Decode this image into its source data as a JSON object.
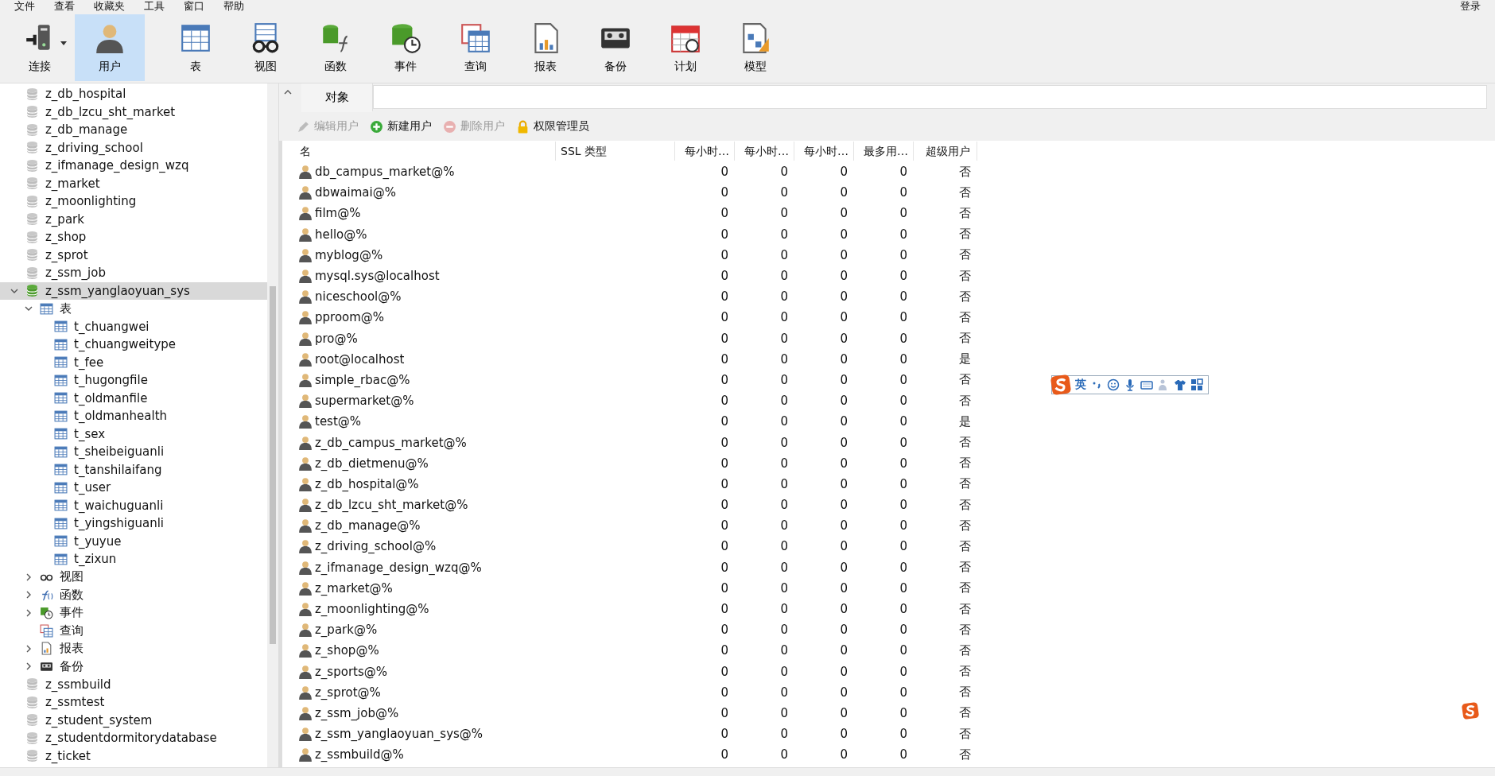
{
  "menu_bar": {
    "items": [
      "文件",
      "查看",
      "收藏夹",
      "工具",
      "窗口",
      "帮助"
    ],
    "login": "登录"
  },
  "toolbar": [
    {
      "label": "连接",
      "kind": "plug",
      "selected": false,
      "dropdown": true
    },
    {
      "label": "用户",
      "kind": "user",
      "selected": true
    },
    {
      "label": "表",
      "kind": "table",
      "selected": false
    },
    {
      "label": "视图",
      "kind": "view",
      "selected": false
    },
    {
      "label": "函数",
      "kind": "function",
      "selected": false
    },
    {
      "label": "事件",
      "kind": "event",
      "selected": false
    },
    {
      "label": "查询",
      "kind": "query",
      "selected": false
    },
    {
      "label": "报表",
      "kind": "report",
      "selected": false
    },
    {
      "label": "备份",
      "kind": "backup",
      "selected": false
    },
    {
      "label": "计划",
      "kind": "schedule",
      "selected": false
    },
    {
      "label": "模型",
      "kind": "model",
      "selected": false
    }
  ],
  "tree": [
    {
      "label": "z_db_hospital",
      "kind": "database",
      "open": false,
      "selected": false
    },
    {
      "label": "z_db_lzcu_sht_market",
      "kind": "database",
      "open": false,
      "selected": false
    },
    {
      "label": "z_db_manage",
      "kind": "database",
      "open": false,
      "selected": false
    },
    {
      "label": "z_driving_school",
      "kind": "database",
      "open": false,
      "selected": false
    },
    {
      "label": "z_ifmanage_design_wzq",
      "kind": "database",
      "open": false,
      "selected": false
    },
    {
      "label": "z_market",
      "kind": "database",
      "open": false,
      "selected": false
    },
    {
      "label": "z_moonlighting",
      "kind": "database",
      "open": false,
      "selected": false
    },
    {
      "label": "z_park",
      "kind": "database",
      "open": false,
      "selected": false
    },
    {
      "label": "z_shop",
      "kind": "database",
      "open": false,
      "selected": false
    },
    {
      "label": "z_sprot",
      "kind": "database",
      "open": false,
      "selected": false
    },
    {
      "label": "z_ssm_job",
      "kind": "database",
      "open": false,
      "selected": false
    },
    {
      "label": "z_ssm_yanglaoyuan_sys",
      "kind": "database",
      "open": true,
      "selected": true,
      "expanded": true,
      "children": [
        {
          "label": "表",
          "kind": "tables",
          "expanded": true,
          "selected": false,
          "children": [
            {
              "label": "t_chuangwei",
              "kind": "table",
              "selected": false
            },
            {
              "label": "t_chuangweitype",
              "kind": "table",
              "selected": false
            },
            {
              "label": "t_fee",
              "kind": "table",
              "selected": false
            },
            {
              "label": "t_hugongfile",
              "kind": "table",
              "selected": false
            },
            {
              "label": "t_oldmanfile",
              "kind": "table",
              "selected": false
            },
            {
              "label": "t_oldmanhealth",
              "kind": "table",
              "selected": false
            },
            {
              "label": "t_sex",
              "kind": "table",
              "selected": false
            },
            {
              "label": "t_sheibeiguanli",
              "kind": "table",
              "selected": false
            },
            {
              "label": "t_tanshilaifang",
              "kind": "table",
              "selected": false
            },
            {
              "label": "t_user",
              "kind": "table",
              "selected": false
            },
            {
              "label": "t_waichuguanli",
              "kind": "table",
              "selected": false
            },
            {
              "label": "t_yingshiguanli",
              "kind": "table",
              "selected": false
            },
            {
              "label": "t_yuyue",
              "kind": "table",
              "selected": false
            },
            {
              "label": "t_zixun",
              "kind": "table",
              "selected": false
            }
          ]
        },
        {
          "label": "视图",
          "kind": "view",
          "expanded": false,
          "selected": false
        },
        {
          "label": "函数",
          "kind": "function",
          "expanded": false,
          "selected": false
        },
        {
          "label": "事件",
          "kind": "event",
          "expanded": false,
          "selected": false
        },
        {
          "label": "查询",
          "kind": "query",
          "selected": false
        },
        {
          "label": "报表",
          "kind": "report",
          "expanded": false,
          "selected": false
        },
        {
          "label": "备份",
          "kind": "backup",
          "expanded": false,
          "selected": false
        }
      ]
    },
    {
      "label": "z_ssmbuild",
      "kind": "database",
      "open": false,
      "selected": false
    },
    {
      "label": "z_ssmtest",
      "kind": "database",
      "open": false,
      "selected": false
    },
    {
      "label": "z_student_system",
      "kind": "database",
      "open": false,
      "selected": false
    },
    {
      "label": "z_studentdormitorydatabase",
      "kind": "database",
      "open": false,
      "selected": false
    },
    {
      "label": "z_ticket",
      "kind": "database",
      "open": false,
      "selected": false
    }
  ],
  "tabs": [
    {
      "label": "对象",
      "selected": true
    }
  ],
  "actions": [
    {
      "label": "编辑用户",
      "kind": "edit",
      "disabled": true
    },
    {
      "label": "新建用户",
      "kind": "add",
      "disabled": false
    },
    {
      "label": "删除用户",
      "kind": "delete",
      "disabled": true
    },
    {
      "label": "权限管理员",
      "kind": "lock",
      "disabled": false
    }
  ],
  "table": {
    "columns": [
      "名",
      "SSL 类型",
      "每小时…",
      "每小时…",
      "每小时…",
      "最多用…",
      "超级用户"
    ],
    "rows": [
      {
        "name": "db_campus_market@%",
        "values": [
          "0",
          "0",
          "0",
          "0",
          "否"
        ]
      },
      {
        "name": "dbwaimai@%",
        "values": [
          "0",
          "0",
          "0",
          "0",
          "否"
        ]
      },
      {
        "name": "film@%",
        "values": [
          "0",
          "0",
          "0",
          "0",
          "否"
        ]
      },
      {
        "name": "hello@%",
        "values": [
          "0",
          "0",
          "0",
          "0",
          "否"
        ]
      },
      {
        "name": "myblog@%",
        "values": [
          "0",
          "0",
          "0",
          "0",
          "否"
        ]
      },
      {
        "name": "mysql.sys@localhost",
        "values": [
          "0",
          "0",
          "0",
          "0",
          "否"
        ]
      },
      {
        "name": "niceschool@%",
        "values": [
          "0",
          "0",
          "0",
          "0",
          "否"
        ]
      },
      {
        "name": "pproom@%",
        "values": [
          "0",
          "0",
          "0",
          "0",
          "否"
        ]
      },
      {
        "name": "pro@%",
        "values": [
          "0",
          "0",
          "0",
          "0",
          "否"
        ]
      },
      {
        "name": "root@localhost",
        "values": [
          "0",
          "0",
          "0",
          "0",
          "是"
        ]
      },
      {
        "name": "simple_rbac@%",
        "values": [
          "0",
          "0",
          "0",
          "0",
          "否"
        ]
      },
      {
        "name": "supermarket@%",
        "values": [
          "0",
          "0",
          "0",
          "0",
          "否"
        ]
      },
      {
        "name": "test@%",
        "values": [
          "0",
          "0",
          "0",
          "0",
          "是"
        ]
      },
      {
        "name": "z_db_campus_market@%",
        "values": [
          "0",
          "0",
          "0",
          "0",
          "否"
        ]
      },
      {
        "name": "z_db_dietmenu@%",
        "values": [
          "0",
          "0",
          "0",
          "0",
          "否"
        ]
      },
      {
        "name": "z_db_hospital@%",
        "values": [
          "0",
          "0",
          "0",
          "0",
          "否"
        ]
      },
      {
        "name": "z_db_lzcu_sht_market@%",
        "values": [
          "0",
          "0",
          "0",
          "0",
          "否"
        ]
      },
      {
        "name": "z_db_manage@%",
        "values": [
          "0",
          "0",
          "0",
          "0",
          "否"
        ]
      },
      {
        "name": "z_driving_school@%",
        "values": [
          "0",
          "0",
          "0",
          "0",
          "否"
        ]
      },
      {
        "name": "z_ifmanage_design_wzq@%",
        "values": [
          "0",
          "0",
          "0",
          "0",
          "否"
        ]
      },
      {
        "name": "z_market@%",
        "values": [
          "0",
          "0",
          "0",
          "0",
          "否"
        ]
      },
      {
        "name": "z_moonlighting@%",
        "values": [
          "0",
          "0",
          "0",
          "0",
          "否"
        ]
      },
      {
        "name": "z_park@%",
        "values": [
          "0",
          "0",
          "0",
          "0",
          "否"
        ]
      },
      {
        "name": "z_shop@%",
        "values": [
          "0",
          "0",
          "0",
          "0",
          "否"
        ]
      },
      {
        "name": "z_sports@%",
        "values": [
          "0",
          "0",
          "0",
          "0",
          "否"
        ]
      },
      {
        "name": "z_sprot@%",
        "values": [
          "0",
          "0",
          "0",
          "0",
          "否"
        ]
      },
      {
        "name": "z_ssm_job@%",
        "values": [
          "0",
          "0",
          "0",
          "0",
          "否"
        ]
      },
      {
        "name": "z_ssm_yanglaoyuan_sys@%",
        "values": [
          "0",
          "0",
          "0",
          "0",
          "否"
        ]
      },
      {
        "name": "z_ssmbuild@%",
        "values": [
          "0",
          "0",
          "0",
          "0",
          "否"
        ]
      }
    ]
  },
  "ime_toolbar": {
    "mode": "英"
  }
}
